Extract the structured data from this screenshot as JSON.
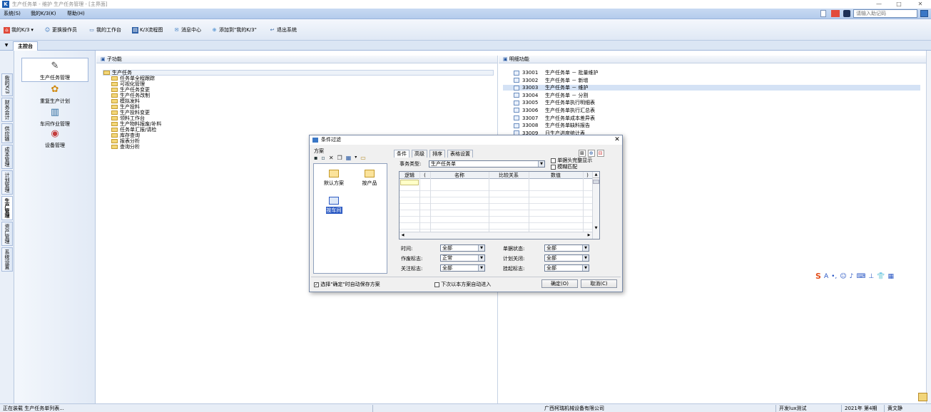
{
  "window": {
    "app_icon": "K",
    "title": "生产任务单 - 维护 生产任务管理 - [主界面]",
    "buttons": {
      "minimize": "—",
      "maximize": "□",
      "close": "✕"
    }
  },
  "menubar": {
    "items": [
      "系统(S)",
      "我的K/3(K)",
      "帮助(H)"
    ],
    "search_placeholder": "请输入助记码"
  },
  "toolbar": {
    "items": [
      {
        "label": "我的K/3",
        "icon": "home-icon"
      },
      {
        "label": "更换操作员",
        "icon": "users-icon"
      },
      {
        "label": "我的工作台",
        "icon": "desk-icon"
      },
      {
        "label": "K/3流程图",
        "icon": "flowchart-icon"
      },
      {
        "label": "消息中心",
        "icon": "message-icon"
      },
      {
        "label": "添加到\"我的K/3\"",
        "icon": "add-icon"
      },
      {
        "label": "退出系统",
        "icon": "exit-icon"
      }
    ]
  },
  "tabbar": {
    "tab_main": "主控台"
  },
  "left_rail": {
    "tabs": [
      "我的K/3",
      "财务会计",
      "供应链",
      "成本管理",
      "计划管理",
      "生产管理",
      "资产管理",
      "系统设置"
    ],
    "active_index": 5
  },
  "modules": [
    {
      "label": "生产任务管理",
      "icon": "task-icon"
    },
    {
      "label": "重复生产计划",
      "icon": "repeat-plan-icon"
    },
    {
      "label": "车间作业管理",
      "icon": "workshop-icon"
    },
    {
      "label": "设备管理",
      "icon": "equipment-icon"
    }
  ],
  "subfunctions": {
    "header": "子功能",
    "root": "生产任务",
    "children": [
      "任务单全程跟踪",
      "可视化管理",
      "生产任务变更",
      "生产任务改制",
      "模拟发料",
      "生产投料",
      "生产投料变更",
      "领料工作台",
      "生产物料报废/补料",
      "任务单汇报/请检",
      "库存查询",
      "报表分析",
      "查询分析"
    ]
  },
  "details": {
    "header": "明细功能",
    "selected_index": 2,
    "items": [
      {
        "code": "33001",
        "name": "生产任务单 － 批量维护"
      },
      {
        "code": "33002",
        "name": "生产任务单 － 新增"
      },
      {
        "code": "33003",
        "name": "生产任务单 － 维护"
      },
      {
        "code": "33004",
        "name": "生产任务单 － 分割"
      },
      {
        "code": "33005",
        "name": "生产任务单执行明细表"
      },
      {
        "code": "33006",
        "name": "生产任务单执行汇总表"
      },
      {
        "code": "33007",
        "name": "生产任务单成本差异表"
      },
      {
        "code": "33008",
        "name": "生产任务单缺料报告"
      },
      {
        "code": "33009",
        "name": "日生产进度统计表"
      }
    ]
  },
  "dialog": {
    "title": "条件过滤",
    "close": "✕",
    "scheme_label": "方案",
    "schemes": [
      {
        "label": "默认方案"
      },
      {
        "label": "按产品"
      },
      {
        "label": "按车间",
        "selected": true
      }
    ],
    "tabs": [
      "条件",
      "高级",
      "排序",
      "表格设置"
    ],
    "biz_type_label": "事务类型:",
    "biz_type_value": "生产任务单",
    "chk_show_all": "单据头完整显示",
    "chk_fuzzy": "模糊匹配",
    "grid_headers": [
      "逻辑",
      "(",
      "名称",
      "比较关系",
      "数值",
      ")"
    ],
    "fields": [
      {
        "label": "时间:",
        "value": "全部"
      },
      {
        "label": "作废标志:",
        "value": "正常"
      },
      {
        "label": "关注标志:",
        "value": "全部"
      },
      {
        "label": "单据状态:",
        "value": "全部"
      },
      {
        "label": "计划关闭:",
        "value": "全部"
      },
      {
        "label": "挂起标志:",
        "value": "全部"
      }
    ],
    "footer_chk1": "选择\"确定\"时自动保存方案",
    "footer_chk2": "下次以本方案自动进入",
    "ok": "确定(O)",
    "cancel": "取消(C)"
  },
  "ime": {
    "logo": "S",
    "items": [
      "A",
      "•,",
      "☺",
      "♪",
      "⌨",
      "⊥",
      "👕",
      "▦"
    ]
  },
  "statusbar": {
    "left": "正在装载 生产任务单列表...",
    "company": "广西柯瑞机械设备有限公司",
    "account": "开发lux测试",
    "period": "2021年 第4期",
    "user": "黄文静"
  },
  "colors": {
    "accent": "#2e5cc4",
    "menubar": "#c8daf2",
    "selection": "#d4e2f5"
  }
}
